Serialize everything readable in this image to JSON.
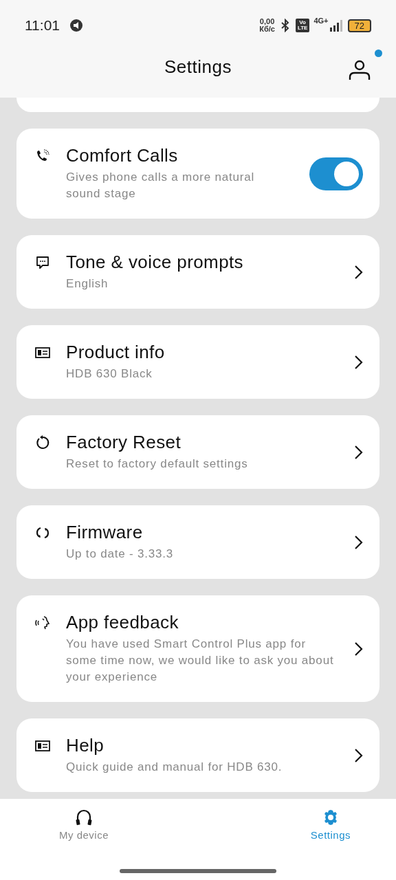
{
  "status_bar": {
    "time": "11:01",
    "speed_value": "0,00",
    "speed_unit": "Кб/с",
    "volte_top": "Vo",
    "volte_bottom": "LTE",
    "network": "4G+",
    "battery": "72"
  },
  "header": {
    "title": "Settings",
    "notification_dot": true
  },
  "settings": [
    {
      "kind": "toggle",
      "title": "Comfort Calls",
      "subtitle": "Gives phone calls a more natural sound stage",
      "on": true
    },
    {
      "kind": "link",
      "title": "Tone & voice prompts",
      "subtitle": "English"
    },
    {
      "kind": "link",
      "title": "Product info",
      "subtitle": "HDB 630 Black"
    },
    {
      "kind": "link",
      "title": "Factory Reset",
      "subtitle": "Reset to factory default settings"
    },
    {
      "kind": "link",
      "title": "Firmware",
      "subtitle": "Up to date - 3.33.3"
    },
    {
      "kind": "link",
      "title": "App feedback",
      "subtitle": "You have used Smart Control Plus app for some time now, we would like to ask you about your experience"
    },
    {
      "kind": "link",
      "title": "Help",
      "subtitle": "Quick guide and manual for HDB 630."
    }
  ],
  "bottom_nav": [
    {
      "label": "My device",
      "selected": false
    },
    {
      "label": "Settings",
      "selected": true
    }
  ]
}
